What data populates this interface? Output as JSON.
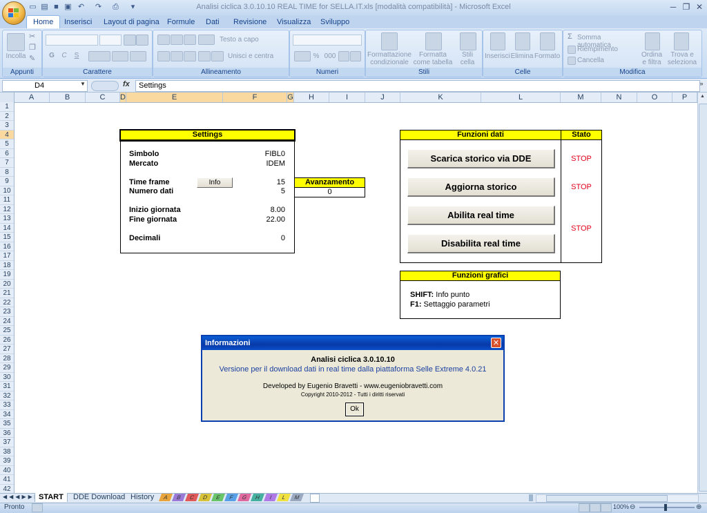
{
  "window": {
    "title": "Analisi ciclica 3.0.10.10 REAL TIME for SELLA.IT.xls  [modalità compatibilità] - Microsoft Excel"
  },
  "ribbon": {
    "tabs": [
      "Home",
      "Inserisci",
      "Layout di pagina",
      "Formule",
      "Dati",
      "Revisione",
      "Visualizza",
      "Sviluppo"
    ],
    "groups": {
      "appunti": "Appunti",
      "carattere": "Carattere",
      "allineamento": "Allineamento",
      "numeri": "Numeri",
      "stili": "Stili",
      "celle": "Celle",
      "modifica": "Modifica"
    },
    "buttons": {
      "incolla": "Incolla",
      "testo_a_capo": "Testo a capo",
      "unisci": "Unisci e centra",
      "formattazione": "Formattazione condizionale",
      "formatta_tabella": "Formatta come tabella",
      "stili_cella": "Stili cella",
      "inserisci": "Inserisci",
      "elimina": "Elimina",
      "formato": "Formato",
      "somma": "Somma automatica",
      "riempimento": "Riempimento",
      "cancella": "Cancella",
      "ordina": "Ordina e filtra",
      "trova": "Trova e seleziona",
      "bold": "G",
      "italic": "C",
      "underline": "S",
      "percent": "%",
      "thousands": "000"
    }
  },
  "formula_bar": {
    "name_box": "D4",
    "fx": "fx",
    "content": "Settings"
  },
  "grid": {
    "columns": [
      "A",
      "B",
      "C",
      "D",
      "E",
      "F",
      "G",
      "H",
      "I",
      "J",
      "K",
      "L",
      "M",
      "N",
      "O",
      "P"
    ],
    "rows": [
      "1",
      "2",
      "3",
      "4",
      "5",
      "6",
      "7",
      "8",
      "9",
      "10",
      "11",
      "12",
      "13",
      "14",
      "15",
      "16",
      "17",
      "18",
      "19",
      "20",
      "21",
      "22",
      "23",
      "24",
      "25",
      "26",
      "27",
      "28",
      "29",
      "30",
      "31",
      "32",
      "33",
      "34",
      "35",
      "36",
      "37",
      "38",
      "39",
      "40",
      "41",
      "42"
    ]
  },
  "settings_panel": {
    "title": "Settings",
    "simbolo_label": "Simbolo",
    "simbolo_value": "FIBL0",
    "mercato_label": "Mercato",
    "mercato_value": "IDEM",
    "timeframe_label": "Time frame",
    "timeframe_value": "15",
    "info_button": "Info",
    "numero_label": "Numero dati",
    "numero_value": "5",
    "inizio_label": "Inizio giornata",
    "inizio_value": "8.00",
    "fine_label": "Fine giornata",
    "fine_value": "22.00",
    "decimali_label": "Decimali",
    "decimali_value": "0"
  },
  "avanzamento": {
    "title": "Avanzamento",
    "value": "0"
  },
  "funzioni_dati": {
    "title": "Funzioni dati",
    "stato_title": "Stato",
    "btn_scarica": "Scarica storico via DDE",
    "btn_aggiorna": "Aggiorna storico",
    "btn_abilita": "Abilita real time",
    "btn_disabilita": "Disabilita real time",
    "stato_1": "STOP",
    "stato_2": "STOP",
    "stato_3": "STOP"
  },
  "funzioni_grafici": {
    "title": "Funzioni grafici",
    "line1_key": "SHIFT:",
    "line1_text": " Info punto",
    "line2_key": "F1:",
    "line2_text": " Settaggio parametri"
  },
  "dialog": {
    "title": "Informazioni",
    "line1": "Analisi ciclica 3.0.10.10",
    "line2": "Versione per il download dati in real time dalla piattaforma Selle Extreme 4.0.21",
    "line3": "Developed by Eugenio Bravetti - www.eugeniobravetti.com",
    "line4": "Copyright 2010-2012 - Tutti i diritti riservati",
    "ok": "Ok",
    "close": "✕"
  },
  "sheet_tabs": {
    "tabs": [
      "START",
      "DDE Download",
      "History"
    ],
    "color_tabs": [
      "A",
      "B",
      "C",
      "D",
      "E",
      "F",
      "G",
      "H",
      "I",
      "L",
      "M"
    ],
    "color_tab_colors": [
      "#e8a33a",
      "#9a7ad6",
      "#e05a5a",
      "#d8c23a",
      "#6ac46a",
      "#5aa0e6",
      "#e06aa0",
      "#46b0a0",
      "#b07ae6",
      "#f0e040",
      "#9aa8c0"
    ]
  },
  "status_bar": {
    "text": "Pronto",
    "zoom": "100%"
  },
  "colors": {
    "accent": "#ffff00",
    "stop": "#e2001a",
    "dialog_title": "#0a3fb0",
    "dialog_text": "#1a3fa0"
  }
}
